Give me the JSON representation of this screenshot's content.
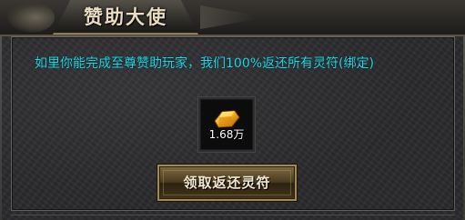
{
  "window": {
    "title": "赞助大使"
  },
  "info": {
    "message": "如里你能完成至尊赞助玩家，我们100%返还所有灵符(绑定)"
  },
  "reward": {
    "icon": "gold-ingot-icon",
    "count_label": "1.68万"
  },
  "actions": {
    "claim_label": "领取返还灵符"
  },
  "colors": {
    "message_text": "#20d8e8",
    "title_text": "#e9dcc0",
    "button_text": "#f3e9cf",
    "panel_bg": "#2b2b2e"
  }
}
